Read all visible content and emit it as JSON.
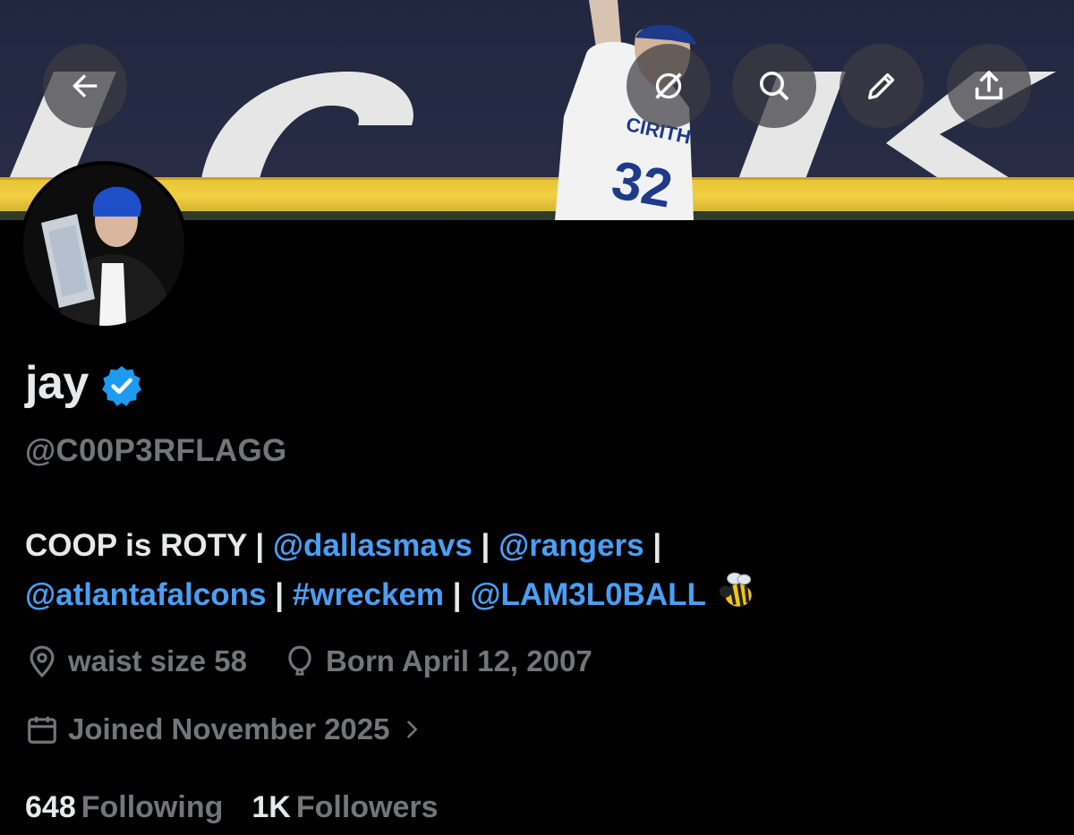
{
  "header": {
    "back_icon": "arrow-left-icon",
    "grok_icon": "grok-icon",
    "search_icon": "search-icon",
    "edit_icon": "pencil-icon",
    "share_icon": "share-icon"
  },
  "profile": {
    "display_name": "jay",
    "verified": true,
    "handle": "@C00P3RFLAGG",
    "bio": {
      "text_start": "COOP is ROTY",
      "links": [
        "@dallasmavs",
        "@rangers",
        "@atlantafalcons",
        "#wreckem",
        "@LAM3L0BALL"
      ],
      "separator": "|",
      "emoji": "bee"
    },
    "location": "waist size 58",
    "birthday": "Born April 12, 2007",
    "joined": "Joined November 2025"
  },
  "stats": {
    "following_count": "648",
    "following_label": "Following",
    "followers_count": "1K",
    "followers_label": "Followers"
  },
  "colors": {
    "background": "#000000",
    "text": "#e7e9ea",
    "secondary": "#71767b",
    "link": "#4a9ff5",
    "verified": "#1d9bf0"
  }
}
